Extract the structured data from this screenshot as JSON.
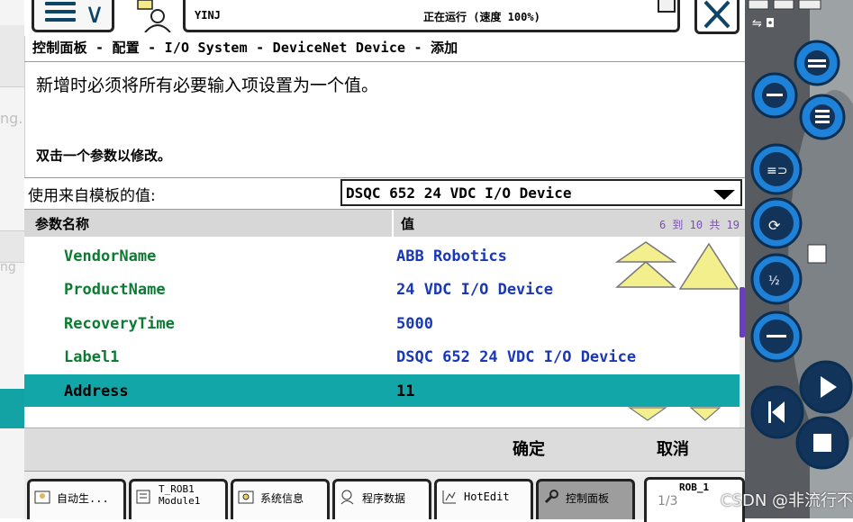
{
  "header": {
    "user": "YINJ",
    "status": "正在运行 (速度 100%)"
  },
  "breadcrumb": "控制面板 - 配置 - I/O System - DeviceNet Device - 添加",
  "message_main": "新增时必须将所有必要输入项设置为一个值。",
  "message_hint": "双击一个参数以修改。",
  "template": {
    "label": "使用来自模板的值:",
    "selected": "DSQC 652 24 VDC I/O Device"
  },
  "table": {
    "col_name": "参数名称",
    "col_value": "值",
    "range": "6 到 10 共 19",
    "rows": [
      {
        "name": "VendorName",
        "value": "ABB Robotics"
      },
      {
        "name": "ProductName",
        "value": "24 VDC I/O Device"
      },
      {
        "name": "RecoveryTime",
        "value": "5000"
      },
      {
        "name": "Label1",
        "value": "DSQC 652 24 VDC I/O Device"
      },
      {
        "name": "Address",
        "value": "11"
      }
    ]
  },
  "footer": {
    "ok": "确定",
    "cancel": "取消"
  },
  "taskbar": {
    "items": [
      {
        "label": "自动生..."
      },
      {
        "label": "T_ROB1\nModule1"
      },
      {
        "label": "系统信息"
      },
      {
        "label": "程序数据"
      },
      {
        "label": "HotEdit"
      },
      {
        "label": "控制面板"
      }
    ],
    "robot": "ROB_1",
    "watermark_left": "1/3",
    "watermark_right": "CSDN @非流行不快乐"
  },
  "colors": {
    "accent": "#12a6a8",
    "param_name": "#0c7a32",
    "param_value": "#1838b8",
    "scroll_thumb": "#6a3fbf"
  }
}
